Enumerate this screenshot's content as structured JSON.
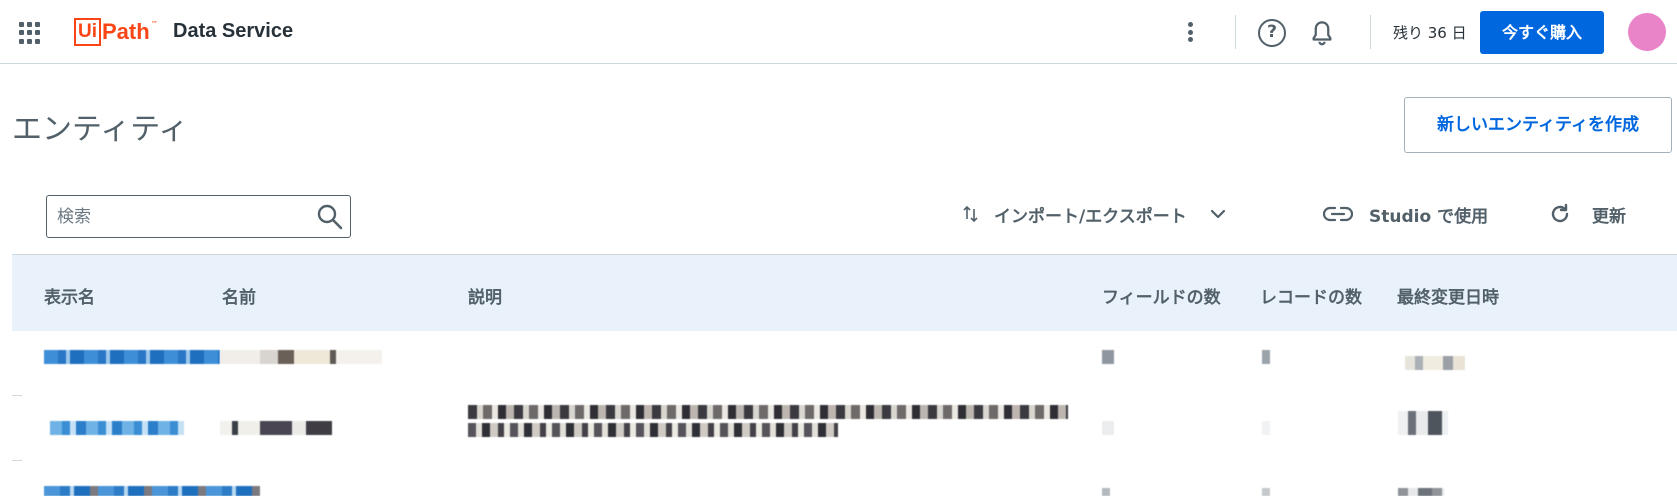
{
  "topbar": {
    "logo_text_ui": "Ui",
    "logo_text_path": "Path",
    "logo_tm": "™",
    "product_name": "Data Service",
    "trial_text": "残り 36 日",
    "buy_label": "今すぐ購入",
    "help_glyph": "?"
  },
  "page": {
    "title": "エンティティ",
    "create_label": "新しいエンティティを作成"
  },
  "toolbar": {
    "search_placeholder": "検索",
    "import_export_label": "インポート/エクスポート",
    "studio_label": "Studio で使用",
    "refresh_label": "更新"
  },
  "table": {
    "columns": [
      "表示名",
      "名前",
      "説明",
      "フィールドの数",
      "レコードの数",
      "最終変更日時"
    ],
    "rows_note_visible_content": "pixelated"
  },
  "colors": {
    "accent": "#0067df",
    "brand": "#fa4616",
    "header_bg": "#e9f1fa",
    "avatar": "#ea84c8"
  },
  "icons": {
    "apps": "apps-grid-icon",
    "more": "more-vertical-icon",
    "help": "help-circle-icon",
    "notifications": "bell-icon",
    "search": "search-icon",
    "import_export": "swap-vertical-icon",
    "dropdown": "chevron-down-icon",
    "link": "link-icon",
    "refresh": "refresh-icon"
  }
}
